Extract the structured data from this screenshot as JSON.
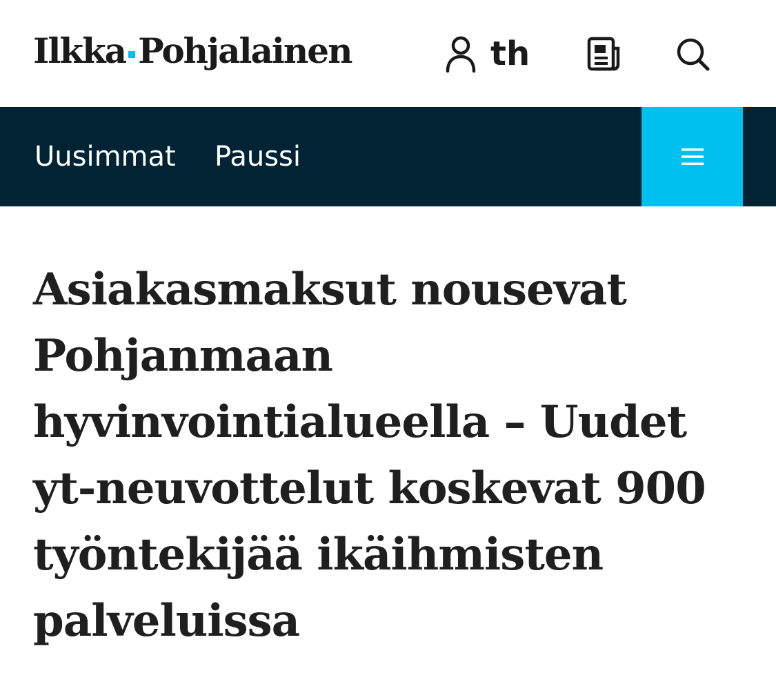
{
  "header": {
    "logo_left": "Ilkka",
    "logo_right": "Pohjalainen",
    "user_initials": "th",
    "icons": {
      "user": "user-icon",
      "newspaper": "newspaper-icon",
      "search": "search-icon",
      "menu": "hamburger-menu-icon"
    }
  },
  "nav": {
    "items": [
      {
        "label": "Uusimmat"
      },
      {
        "label": "Paussi"
      }
    ]
  },
  "article": {
    "headline_lines": [
      "Asiakasmaksut nousevat",
      "Pohjanmaan",
      "hyvinvointialueella – Uudet",
      "yt-neuvottelut koskevat 900",
      "työntekijää ikäihmisten",
      "palveluissa"
    ]
  },
  "colors": {
    "accent": "#00c0f0",
    "nav_background": "#022333",
    "text": "#1f1f1f",
    "background": "#ffffff"
  }
}
